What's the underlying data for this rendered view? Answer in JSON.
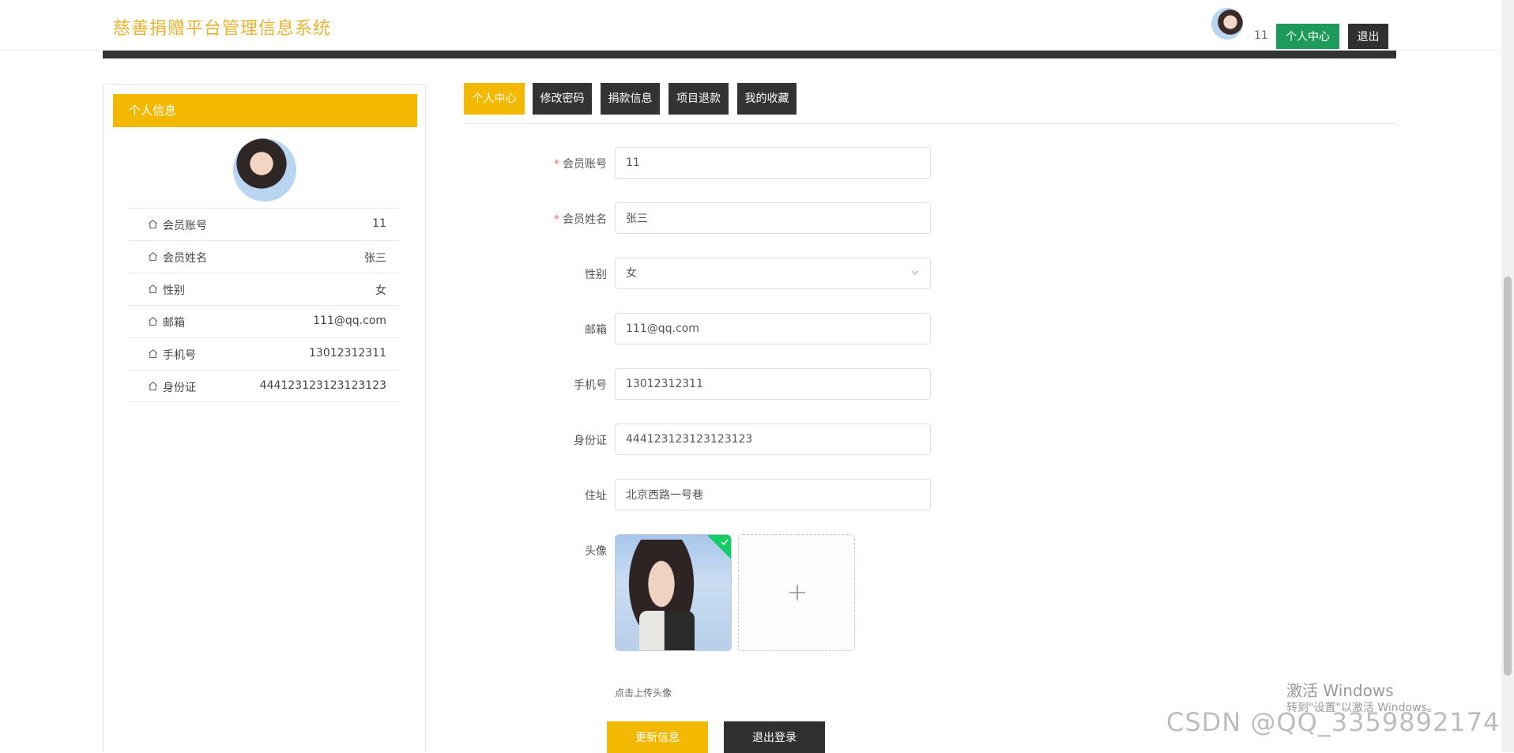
{
  "header": {
    "brand": "慈善捐赠平台管理信息系统",
    "username": "11",
    "center_button": "个人中心",
    "exit_button": "退出"
  },
  "left_panel": {
    "title": "个人信息",
    "rows": [
      {
        "label": "会员账号",
        "value": "11"
      },
      {
        "label": "会员姓名",
        "value": "张三"
      },
      {
        "label": "性别",
        "value": "女"
      },
      {
        "label": "邮箱",
        "value": "111@qq.com"
      },
      {
        "label": "手机号",
        "value": "13012312311"
      },
      {
        "label": "身份证",
        "value": "444123123123123123"
      }
    ]
  },
  "tabs": [
    {
      "label": "个人中心",
      "active": true
    },
    {
      "label": "修改密码",
      "active": false
    },
    {
      "label": "捐款信息",
      "active": false
    },
    {
      "label": "项目退款",
      "active": false
    },
    {
      "label": "我的收藏",
      "active": false
    }
  ],
  "form": {
    "account": {
      "label": "会员账号",
      "value": "11",
      "required": true
    },
    "name": {
      "label": "会员姓名",
      "value": "张三",
      "required": true
    },
    "gender": {
      "label": "性别",
      "value": "女"
    },
    "email": {
      "label": "邮箱",
      "value": "111@qq.com"
    },
    "phone": {
      "label": "手机号",
      "value": "13012312311"
    },
    "idcard": {
      "label": "身份证",
      "value": "444123123123123123"
    },
    "address": {
      "label": "住址",
      "value": "北京西路一号巷"
    },
    "avatar": {
      "label": "头像",
      "hint": "点击上传头像"
    }
  },
  "buttons": {
    "update": "更新信息",
    "logout": "退出登录"
  },
  "watermarks": {
    "activate_title": "激活 Windows",
    "activate_sub": "转到\"设置\"以激活 Windows。",
    "csdn": "CSDN @QQ_3359892174"
  },
  "colors": {
    "accent": "#f3b800",
    "brand_text": "#e6b32e",
    "green_button": "#1e9b5a",
    "dark": "#333333"
  }
}
